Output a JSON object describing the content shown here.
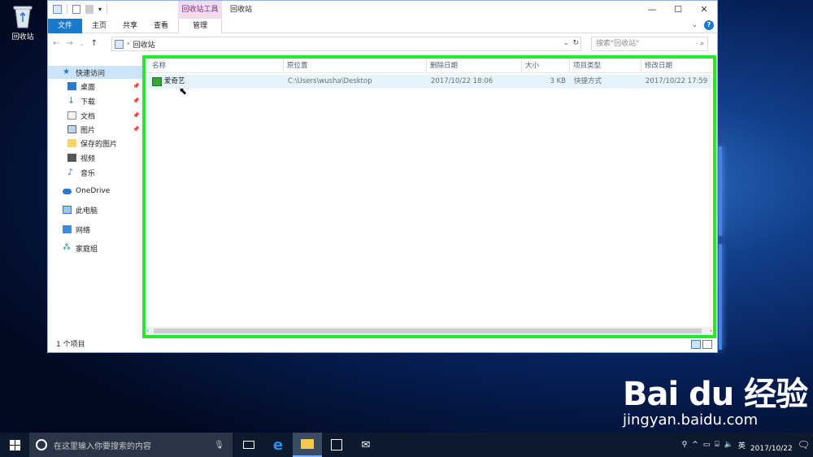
{
  "desktop": {
    "icon_label": "回收站"
  },
  "window": {
    "context_tab": "回收站工具",
    "title": "回收站",
    "controls": [
      "—",
      "☐",
      "✕"
    ]
  },
  "ribbon": {
    "tabs": [
      "文件",
      "主页",
      "共享",
      "查看",
      "管理"
    ]
  },
  "address": {
    "path": "回收站",
    "search_placeholder": "搜索\"回收站\""
  },
  "nav_pane": {
    "items": [
      {
        "label": "快速访问",
        "icon": "star-icon",
        "pinned": false
      },
      {
        "label": "桌面",
        "icon": "desktop-icon",
        "pinned": true
      },
      {
        "label": "下载",
        "icon": "download-icon",
        "pinned": true
      },
      {
        "label": "文档",
        "icon": "document-icon",
        "pinned": true
      },
      {
        "label": "图片",
        "icon": "pictures-icon",
        "pinned": true
      },
      {
        "label": "保存的图片",
        "icon": "folder-icon",
        "pinned": false
      },
      {
        "label": "视频",
        "icon": "video-icon",
        "pinned": false
      },
      {
        "label": "音乐",
        "icon": "music-icon",
        "pinned": false
      },
      {
        "label": "OneDrive",
        "icon": "cloud-icon",
        "pinned": false
      },
      {
        "label": "此电脑",
        "icon": "computer-icon",
        "pinned": false
      },
      {
        "label": "网络",
        "icon": "network-icon",
        "pinned": false
      },
      {
        "label": "家庭组",
        "icon": "homegroup-icon",
        "pinned": false
      }
    ]
  },
  "columns": [
    "名称",
    "原位置",
    "删除日期",
    "大小",
    "项目类型",
    "修改日期"
  ],
  "files": [
    {
      "name": "爱奇艺",
      "location": "C:\\Users\\wusha\\Desktop",
      "deleted": "2017/10/22 18:06",
      "size": "3 KB",
      "type": "快捷方式",
      "modified": "2017/10/22 17:59"
    }
  ],
  "status": {
    "count": "1 个项目"
  },
  "taskbar": {
    "search_placeholder": "在这里输入你要搜索的内容",
    "ime": "英",
    "date": "2017/10/22"
  },
  "watermark": {
    "brand": "Bai du 经验",
    "url": "jingyan.baidu.com"
  },
  "colors": {
    "highlight_border": "#27e821",
    "file_tab": "#1979ca",
    "context_tab": "#f1dcef",
    "selected_row": "#e5f3fb"
  }
}
